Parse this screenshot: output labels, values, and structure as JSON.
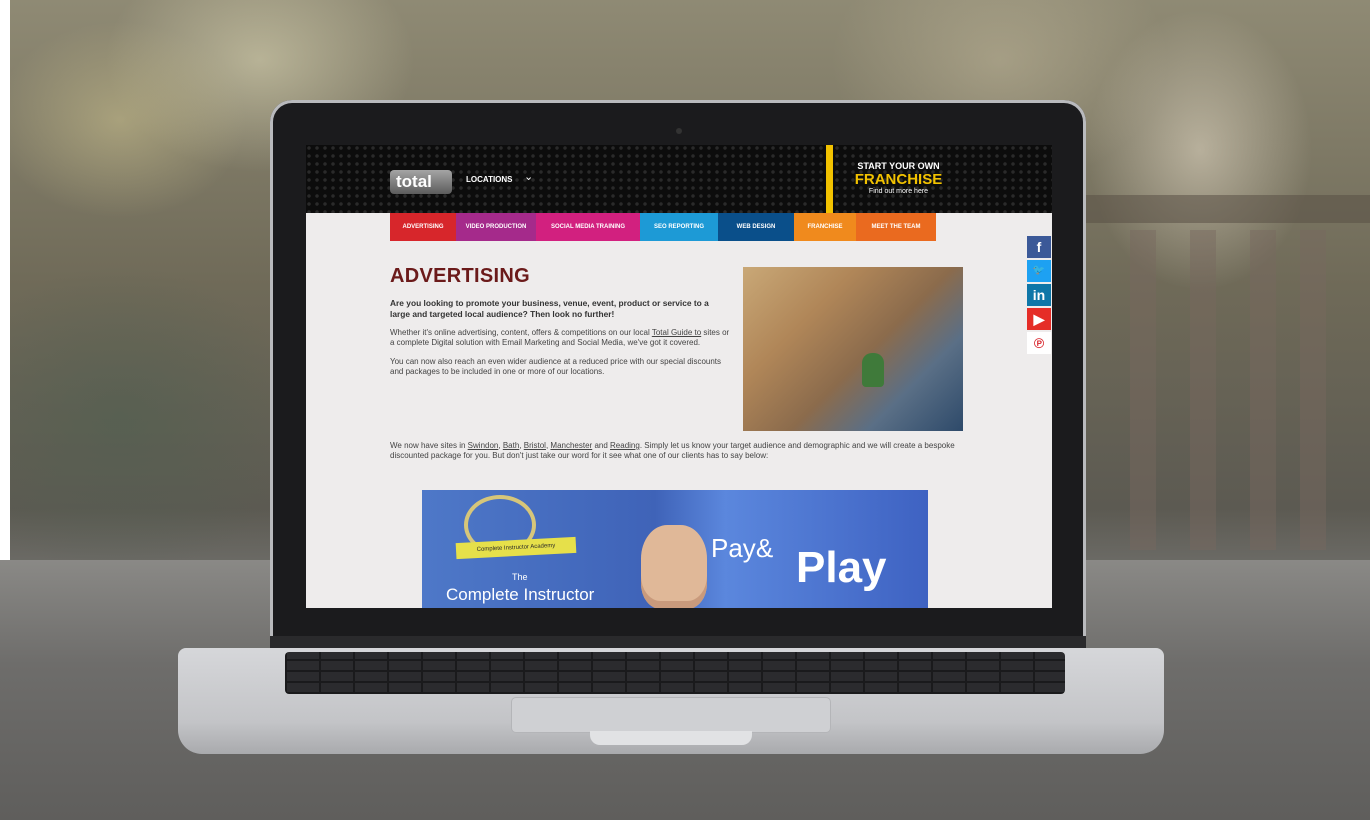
{
  "site": {
    "logo_text": "total",
    "header": {
      "locations_label": "LOCATIONS",
      "chevron": "chevron-down-icon",
      "franchise_line1": "START YOUR OWN",
      "franchise_line2": "FRANCHISE",
      "franchise_line3": "Find out more here"
    },
    "nav": [
      {
        "label": "ADVERTISING",
        "color": "#d7262b",
        "width": 66
      },
      {
        "label": "VIDEO PRODUCTION",
        "color": "#a52a8b",
        "width": 80
      },
      {
        "label": "SOCIAL MEDIA TRAINING",
        "color": "#d2207f",
        "width": 104
      },
      {
        "label": "SEO REPORTING",
        "color": "#1d9ad6",
        "width": 78
      },
      {
        "label": "WEB DESIGN",
        "color": "#0a4f8a",
        "width": 76
      },
      {
        "label": "FRANCHISE",
        "color": "#f08a1d",
        "width": 62
      },
      {
        "label": "MEET THE TEAM",
        "color": "#ea6a1f",
        "width": 80
      }
    ],
    "content": {
      "title": "ADVERTISING",
      "lead": "Are you looking to promote your business, venue, event, product or service to a large and targeted local audience? Then look no further!",
      "p1_before": "Whether it's online advertising, content, offers & competitions on our local ",
      "p1_link": "Total Guide to",
      "p1_after": " sites or a complete Digital solution with Email Marketing and Social Media, we've got it covered.",
      "p2": "You can now also reach an even wider audience at a reduced price with our special discounts and packages to be included in one or more of our locations.",
      "p3_start": "We now have sites in ",
      "p3_links": [
        "Swindon",
        "Bath",
        "Bristol",
        "Manchester",
        "Reading"
      ],
      "p3_and": " and ",
      "p3_end": ". Simply let us know your target audience and demographic and we will create a bespoke discounted package for you. But don't just take our word for it see what one of our clients has to say below:"
    },
    "video": {
      "ribbon": "Complete Instructor Academy",
      "the": "The",
      "complete_instructor": "Complete Instructor",
      "pay": "Pay",
      "amp": "&",
      "play": "Play"
    },
    "social": [
      {
        "icon": "facebook-icon",
        "glyph": "f",
        "color": "#3b5998"
      },
      {
        "icon": "twitter-icon",
        "glyph": "🐦",
        "color": "#1da1f2"
      },
      {
        "icon": "linkedin-icon",
        "glyph": "in",
        "color": "#0e76a8"
      },
      {
        "icon": "youtube-icon",
        "glyph": "▶",
        "color": "#e52d27"
      },
      {
        "icon": "pinterest-icon",
        "glyph": "℗",
        "color": "#ffffff"
      }
    ]
  }
}
